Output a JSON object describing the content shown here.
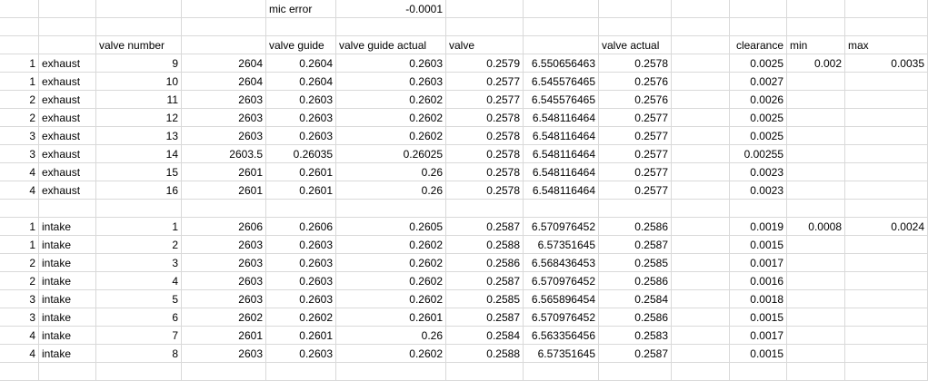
{
  "mic_error": {
    "label": "mic error",
    "value": "-0.0001"
  },
  "headers": {
    "valve_number": "valve number",
    "valve_guide": "valve guide",
    "valve_guide_actual": "valve guide actual",
    "valve": "valve",
    "valve_actual": "valve actual",
    "clearance": "clearance",
    "min": "min",
    "max": "max"
  },
  "exhaust_rows": [
    {
      "cyl": "1",
      "type": "exhaust",
      "num": "9",
      "raw_guide": "2604",
      "guide": "0.2604",
      "guide_actual": "0.2603",
      "valve": "0.2579",
      "mm": "6.550656463",
      "valve_actual": "0.2578",
      "clearance": "0.0025",
      "min": "0.002",
      "max": "0.0035"
    },
    {
      "cyl": "1",
      "type": "exhaust",
      "num": "10",
      "raw_guide": "2604",
      "guide": "0.2604",
      "guide_actual": "0.2603",
      "valve": "0.2577",
      "mm": "6.545576465",
      "valve_actual": "0.2576",
      "clearance": "0.0027",
      "min": "",
      "max": ""
    },
    {
      "cyl": "2",
      "type": "exhaust",
      "num": "11",
      "raw_guide": "2603",
      "guide": "0.2603",
      "guide_actual": "0.2602",
      "valve": "0.2577",
      "mm": "6.545576465",
      "valve_actual": "0.2576",
      "clearance": "0.0026",
      "min": "",
      "max": ""
    },
    {
      "cyl": "2",
      "type": "exhaust",
      "num": "12",
      "raw_guide": "2603",
      "guide": "0.2603",
      "guide_actual": "0.2602",
      "valve": "0.2578",
      "mm": "6.548116464",
      "valve_actual": "0.2577",
      "clearance": "0.0025",
      "min": "",
      "max": ""
    },
    {
      "cyl": "3",
      "type": "exhaust",
      "num": "13",
      "raw_guide": "2603",
      "guide": "0.2603",
      "guide_actual": "0.2602",
      "valve": "0.2578",
      "mm": "6.548116464",
      "valve_actual": "0.2577",
      "clearance": "0.0025",
      "min": "",
      "max": ""
    },
    {
      "cyl": "3",
      "type": "exhaust",
      "num": "14",
      "raw_guide": "2603.5",
      "guide": "0.26035",
      "guide_actual": "0.26025",
      "valve": "0.2578",
      "mm": "6.548116464",
      "valve_actual": "0.2577",
      "clearance": "0.00255",
      "min": "",
      "max": ""
    },
    {
      "cyl": "4",
      "type": "exhaust",
      "num": "15",
      "raw_guide": "2601",
      "guide": "0.2601",
      "guide_actual": "0.26",
      "valve": "0.2578",
      "mm": "6.548116464",
      "valve_actual": "0.2577",
      "clearance": "0.0023",
      "min": "",
      "max": ""
    },
    {
      "cyl": "4",
      "type": "exhaust",
      "num": "16",
      "raw_guide": "2601",
      "guide": "0.2601",
      "guide_actual": "0.26",
      "valve": "0.2578",
      "mm": "6.548116464",
      "valve_actual": "0.2577",
      "clearance": "0.0023",
      "min": "",
      "max": ""
    }
  ],
  "intake_rows": [
    {
      "cyl": "1",
      "type": "intake",
      "num": "1",
      "raw_guide": "2606",
      "guide": "0.2606",
      "guide_actual": "0.2605",
      "valve": "0.2587",
      "mm": "6.570976452",
      "valve_actual": "0.2586",
      "clearance": "0.0019",
      "min": "0.0008",
      "max": "0.0024"
    },
    {
      "cyl": "1",
      "type": "intake",
      "num": "2",
      "raw_guide": "2603",
      "guide": "0.2603",
      "guide_actual": "0.2602",
      "valve": "0.2588",
      "mm": "6.57351645",
      "valve_actual": "0.2587",
      "clearance": "0.0015",
      "min": "",
      "max": ""
    },
    {
      "cyl": "2",
      "type": "intake",
      "num": "3",
      "raw_guide": "2603",
      "guide": "0.2603",
      "guide_actual": "0.2602",
      "valve": "0.2586",
      "mm": "6.568436453",
      "valve_actual": "0.2585",
      "clearance": "0.0017",
      "min": "",
      "max": ""
    },
    {
      "cyl": "2",
      "type": "intake",
      "num": "4",
      "raw_guide": "2603",
      "guide": "0.2603",
      "guide_actual": "0.2602",
      "valve": "0.2587",
      "mm": "6.570976452",
      "valve_actual": "0.2586",
      "clearance": "0.0016",
      "min": "",
      "max": ""
    },
    {
      "cyl": "3",
      "type": "intake",
      "num": "5",
      "raw_guide": "2603",
      "guide": "0.2603",
      "guide_actual": "0.2602",
      "valve": "0.2585",
      "mm": "6.565896454",
      "valve_actual": "0.2584",
      "clearance": "0.0018",
      "min": "",
      "max": ""
    },
    {
      "cyl": "3",
      "type": "intake",
      "num": "6",
      "raw_guide": "2602",
      "guide": "0.2602",
      "guide_actual": "0.2601",
      "valve": "0.2587",
      "mm": "6.570976452",
      "valve_actual": "0.2586",
      "clearance": "0.0015",
      "min": "",
      "max": ""
    },
    {
      "cyl": "4",
      "type": "intake",
      "num": "7",
      "raw_guide": "2601",
      "guide": "0.2601",
      "guide_actual": "0.26",
      "valve": "0.2584",
      "mm": "6.563356456",
      "valve_actual": "0.2583",
      "clearance": "0.0017",
      "min": "",
      "max": ""
    },
    {
      "cyl": "4",
      "type": "intake",
      "num": "8",
      "raw_guide": "2603",
      "guide": "0.2603",
      "guide_actual": "0.2602",
      "valve": "0.2588",
      "mm": "6.57351645",
      "valve_actual": "0.2587",
      "clearance": "0.0015",
      "min": "",
      "max": ""
    }
  ]
}
